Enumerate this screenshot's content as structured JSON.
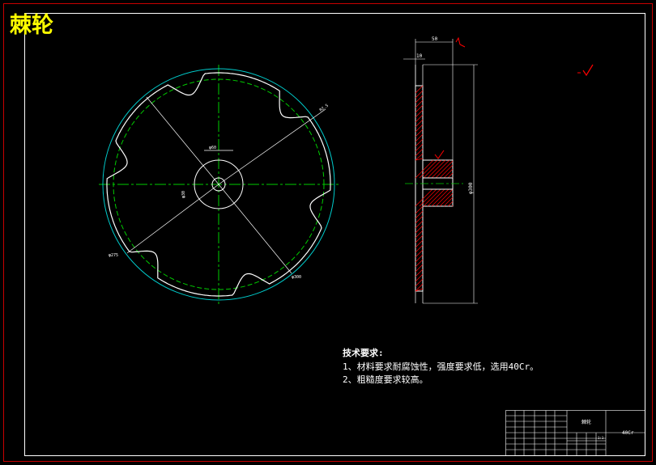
{
  "title": "棘轮",
  "colors": {
    "background": "#000000",
    "outer_border": "#c80000",
    "inner_border": "#ffffff",
    "title": "#ffff00",
    "outline": "#ffffff",
    "tip_circle": "#00cccc",
    "root_circle": "#00cc00",
    "centerline": "#00cc00",
    "hatch": "#ff0000",
    "mark": "#ff0000",
    "note_text": "#ffffff"
  },
  "front_view": {
    "dim_tooth_radius": "R2.5",
    "dim_bore": "φ30",
    "dim_hub": "φ60",
    "dim_root": "φ275",
    "dim_tip": "φ300"
  },
  "side_view": {
    "dim_hub_width": "50",
    "dim_plate_thickness": "10",
    "dim_tip_diameter": "φ300"
  },
  "notes": {
    "heading": "技术要求:",
    "line1": "1、材料要求耐腐蚀性，强度要求低，选用40Cr。",
    "line2": "2、粗糙度要求较高。"
  },
  "title_block": {
    "part_name": "棘轮",
    "material": "40Cr",
    "scale": "1:1"
  }
}
